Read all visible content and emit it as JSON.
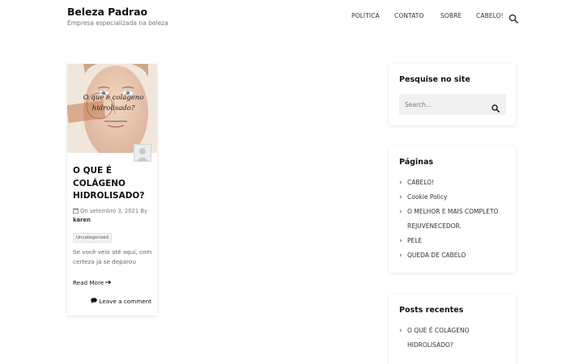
{
  "header": {
    "site_title": "Beleza Padrao",
    "tagline": "Empresa especializada na beleza",
    "nav": [
      "POLÍTICA",
      "CONTATO",
      "SOBRE",
      "CABELO!"
    ],
    "search_icon": "search-icon"
  },
  "post": {
    "image_text_line1": "O que é colágeno",
    "image_text_line2": "hidrolisado?",
    "title": "O QUE É COLÁGENO HIDROLISADO?",
    "date_prefix": "On",
    "date": "setembro 3, 2021",
    "by": "By",
    "author": "karen",
    "category": "Uncategorized",
    "excerpt": "Se você veio até aqui, com certeza já se deparou",
    "read_more": "Read More",
    "read_more_icon": "arrow-right-icon",
    "comment": "Leave a comment",
    "comment_icon": "comment-icon"
  },
  "sidebar": {
    "search": {
      "title": "Pesquise no site",
      "placeholder": "Search..."
    },
    "pages": {
      "title": "Páginas",
      "items": [
        "CABELO!",
        "Cookie Policy",
        "O MELHOR E MAIS COMPLETO REJUVENECEDOR.",
        "PELE",
        "QUEDA DE CABELO"
      ]
    },
    "recent": {
      "title": "Posts recentes",
      "items": [
        "O QUE É COLÁGENO HIDROLISADO?"
      ]
    }
  },
  "colors": {
    "accent": "#111111",
    "background": "#ffffff",
    "widget_bg": "#f1f1f1"
  }
}
